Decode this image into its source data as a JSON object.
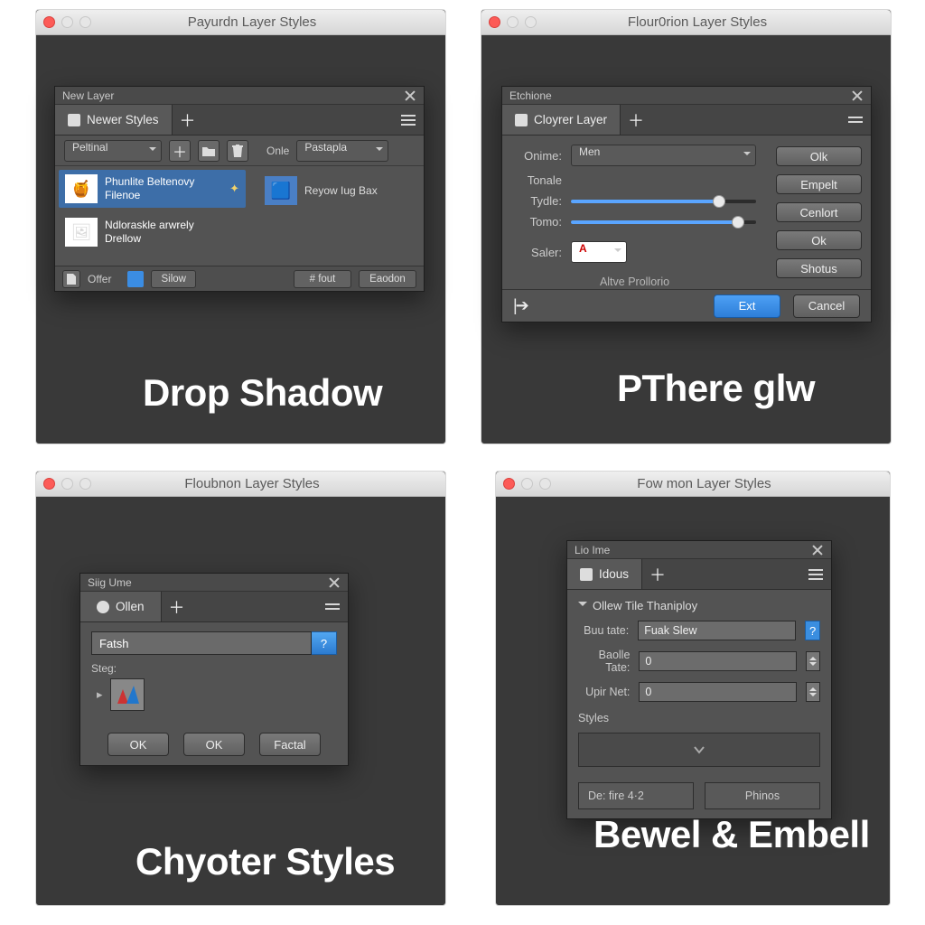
{
  "quadrants": {
    "tl": {
      "title": "Payurdn Layer Styles",
      "label": "Drop Shadow"
    },
    "tr": {
      "title": "Flour0rion Layer Styles",
      "label": "PThere glw"
    },
    "bl": {
      "title": "Floubnon Layer Styles",
      "label": "Chyoter Styles"
    },
    "br": {
      "title": "Fow mon Layer Styles",
      "label": "Bewel & Embell"
    }
  },
  "panelA": {
    "header": "New Layer",
    "tab": "Newer Styles",
    "toolbar": {
      "preset_drop": "Peltinal",
      "onle_label": "Onle",
      "onle_drop": "Pastapla",
      "add_tip": "+"
    },
    "rows": {
      "r1": {
        "line1": "Phunlite Beltenovy",
        "line2": "Filenoe",
        "thumb_glyph": "🍯"
      },
      "r2": {
        "line1": "Ndloraskle arwrely",
        "line2": "Drellow",
        "thumb_glyph": "🖼"
      },
      "rside": {
        "label": "Reyow Iug Bax",
        "thumb_glyph": "🟦"
      }
    },
    "footer": {
      "offer": "Offer",
      "mid1": "Silow",
      "btn1": "# fout",
      "btn2": "Eaodon"
    }
  },
  "panelB": {
    "header": "Etchione",
    "tab": "Cloyrer Layer",
    "form": {
      "onime_label": "Onime:",
      "onime_value": "Men",
      "tonale_label": "Tonale",
      "tydle_label": "Tydle:",
      "tydle_pct": 80,
      "tomo_label": "Tomo:",
      "tomo_pct": 90,
      "saler_label": "Saler:",
      "saler_value": "A",
      "altve": "Altve Prollorio"
    },
    "buttons": {
      "ok1": "Olk",
      "empelt": "Empelt",
      "cenlort": "Cenlort",
      "ok2": "Ok",
      "shotus": "Shotus",
      "ext": "Ext",
      "cancel": "Cancel"
    }
  },
  "panelC": {
    "header": "Siig Ume",
    "tab": "Ollen",
    "input": "Fatsh",
    "stage_label": "Steg:",
    "swatch_glyph": "M",
    "buttons": {
      "ok1": "OK",
      "ok2": "OK",
      "factal": "Factal"
    }
  },
  "panelD": {
    "header": "Lio Ime",
    "tab": "Idous",
    "disclosure": "Ollew Tile Thaniploy",
    "fields": {
      "buutate_label": "Buu tate:",
      "buutate_value": "Fuak Slew",
      "baolle_label": "Baolle Tate:",
      "baolle_value": "0",
      "upir_label": "Upir Net:",
      "upir_value": "0"
    },
    "styles_label": "Styles",
    "footer": {
      "defire": "De: fire 4·2",
      "phinos": "Phinos"
    }
  }
}
